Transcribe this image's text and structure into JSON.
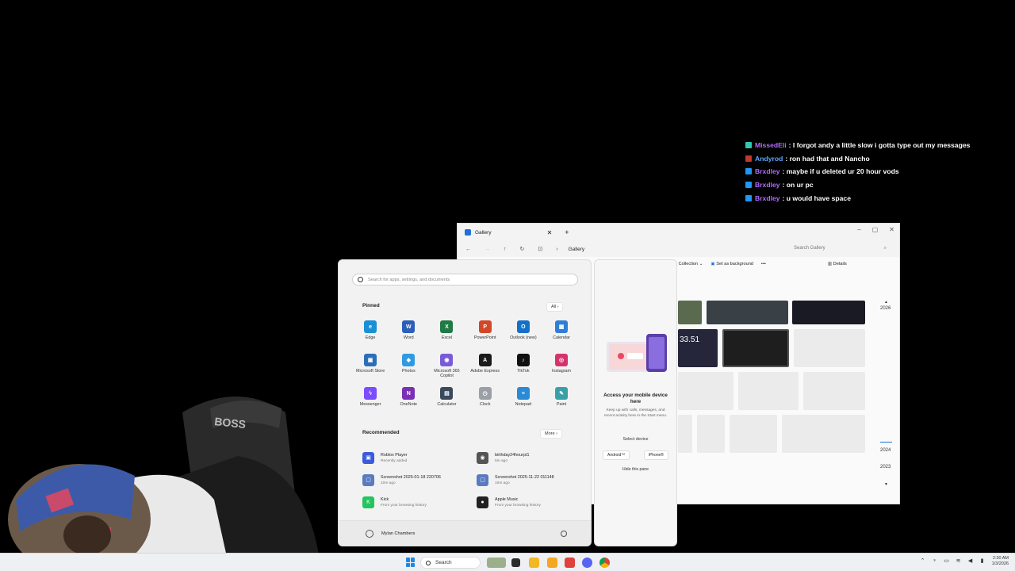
{
  "chat": [
    {
      "user": "MissedEli",
      "text": ": I forgot andy a little slow i gotta type out my messages",
      "user_color": "#b06cff",
      "badge": "#35c6b2"
    },
    {
      "user": "Andyrod",
      "text": ": ron had that and Nancho",
      "user_color": "#5aa9ff",
      "badge": "#c0392b"
    },
    {
      "user": "Brxdley",
      "text": ": maybe if u deleted ur 20 hour vods",
      "user_color": "#b06cff",
      "badge": "#2196f3"
    },
    {
      "user": "Brxdley",
      "text": ": on ur pc",
      "user_color": "#b06cff",
      "badge": "#2196f3"
    },
    {
      "user": "Brxdley",
      "text": ": u would have space",
      "user_color": "#b06cff",
      "badge": "#2196f3"
    }
  ],
  "gallery": {
    "tab_title": "Gallery",
    "breadcrumb": "Gallery",
    "search_placeholder": "Search Gallery",
    "toolbar": {
      "collection": "Collection",
      "set_background": "Set as background",
      "more": "•••",
      "details": "Details"
    },
    "thumb_text": "33.51",
    "years": [
      "2026",
      "2024",
      "2023"
    ]
  },
  "start_menu": {
    "search_placeholder": "Search for apps, settings, and documents",
    "pinned_title": "Pinned",
    "all_button": "All  ›",
    "pinned": [
      {
        "name": "Edge",
        "icon": "edge-icon",
        "color": "#1b8fd6",
        "glyph": "e"
      },
      {
        "name": "Word",
        "icon": "word-icon",
        "color": "#2b5fb8",
        "glyph": "W"
      },
      {
        "name": "Excel",
        "icon": "excel-icon",
        "color": "#1f7a45",
        "glyph": "X"
      },
      {
        "name": "PowerPoint",
        "icon": "powerpoint-icon",
        "color": "#d24726",
        "glyph": "P"
      },
      {
        "name": "Outlook (new)",
        "icon": "outlook-icon",
        "color": "#1471c9",
        "glyph": "O"
      },
      {
        "name": "Calendar",
        "icon": "calendar-icon",
        "color": "#2f7fd8",
        "glyph": "▦"
      },
      {
        "name": "Microsoft Store",
        "icon": "store-icon",
        "color": "#2c6fb7",
        "glyph": "▣"
      },
      {
        "name": "Photos",
        "icon": "photos-icon",
        "color": "#2e9be0",
        "glyph": "◆"
      },
      {
        "name": "Microsoft 365 Copilot",
        "icon": "copilot-icon",
        "color": "#7a5bd6",
        "glyph": "◉"
      },
      {
        "name": "Adobe Express",
        "icon": "adobe-express-icon",
        "color": "#1a1a1a",
        "glyph": "A"
      },
      {
        "name": "TikTok",
        "icon": "tiktok-icon",
        "color": "#111111",
        "glyph": "♪"
      },
      {
        "name": "Instagram",
        "icon": "instagram-icon",
        "color": "#d6336c",
        "glyph": "◎"
      },
      {
        "name": "Messenger",
        "icon": "messenger-icon",
        "color": "#7b4dff",
        "glyph": "ϟ"
      },
      {
        "name": "OneNote",
        "icon": "onenote-icon",
        "color": "#7b2fb5",
        "glyph": "N"
      },
      {
        "name": "Calculator",
        "icon": "calculator-icon",
        "color": "#3a4a5c",
        "glyph": "▤"
      },
      {
        "name": "Clock",
        "icon": "clock-icon",
        "color": "#9aa0a6",
        "glyph": "◷"
      },
      {
        "name": "Notepad",
        "icon": "notepad-icon",
        "color": "#2b8ad6",
        "glyph": "≡"
      },
      {
        "name": "Paint",
        "icon": "paint-icon",
        "color": "#39a0a8",
        "glyph": "✎"
      }
    ],
    "recommended_title": "Recommended",
    "more_button": "More  ›",
    "recommended": [
      {
        "title": "Roblox Player",
        "subtitle": "Recently added",
        "icon": "roblox-icon",
        "color": "#3b5bdb",
        "glyph": "▣"
      },
      {
        "title": "birthday24hourpt1",
        "subtitle": "5m ago",
        "icon": "video-file-icon",
        "color": "#555555",
        "glyph": "◉"
      },
      {
        "title": "Screenshot 2025-01-18 220706",
        "subtitle": "10m ago",
        "icon": "image-file-icon",
        "color": "#5a7bbf",
        "glyph": "▢"
      },
      {
        "title": "Screenshot 2025-11-22 011148",
        "subtitle": "10m ago",
        "icon": "image-file-icon",
        "color": "#5a7bbf",
        "glyph": "▢"
      },
      {
        "title": "Kick",
        "subtitle": "From your browsing history",
        "icon": "kick-icon",
        "color": "#22c55e",
        "glyph": "K"
      },
      {
        "title": "Apple Music",
        "subtitle": "From your browsing history",
        "icon": "apple-icon",
        "color": "#222222",
        "glyph": "●"
      }
    ],
    "user_name": "Mylan Chambers"
  },
  "phone_pane": {
    "title": "Access your mobile device here",
    "description": "Keep up with calls, messages, and recent activity here in the Start menu.",
    "select_device": "Select device",
    "android": "Android™",
    "iphone": "iPhone®",
    "hide": "Hide this pane"
  },
  "taskbar": {
    "search_label": "Search",
    "time": "2:30 AM",
    "date": "1/3/2026"
  }
}
